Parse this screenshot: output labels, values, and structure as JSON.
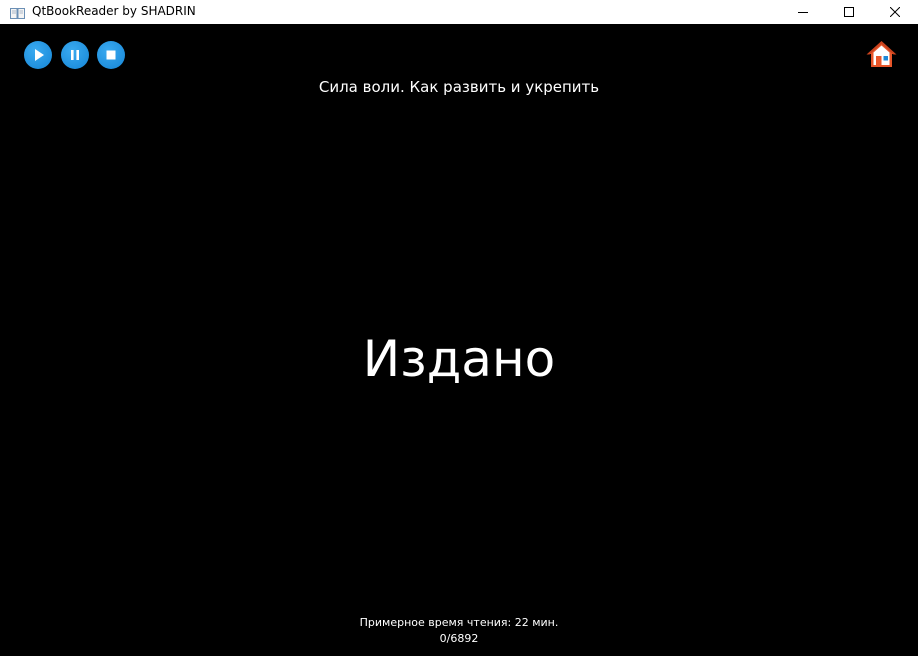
{
  "window": {
    "title": "QtBookReader by SHADRIN",
    "app_icon": "open-book-icon",
    "controls": {
      "minimize_icon": "minimize-icon",
      "maximize_icon": "maximize-icon",
      "close_icon": "close-icon"
    }
  },
  "toolbar": {
    "play_icon": "play-icon",
    "pause_icon": "pause-icon",
    "stop_icon": "stop-icon",
    "home_icon": "home-icon",
    "accent_color": "#2196e3",
    "home_color": "#e8562a"
  },
  "reader": {
    "book_title": "Сила воли. Как развить и укрепить",
    "current_word": "Издано",
    "reading_time": "Примерное время чтения: 22 мин.",
    "progress": "0/6892"
  }
}
